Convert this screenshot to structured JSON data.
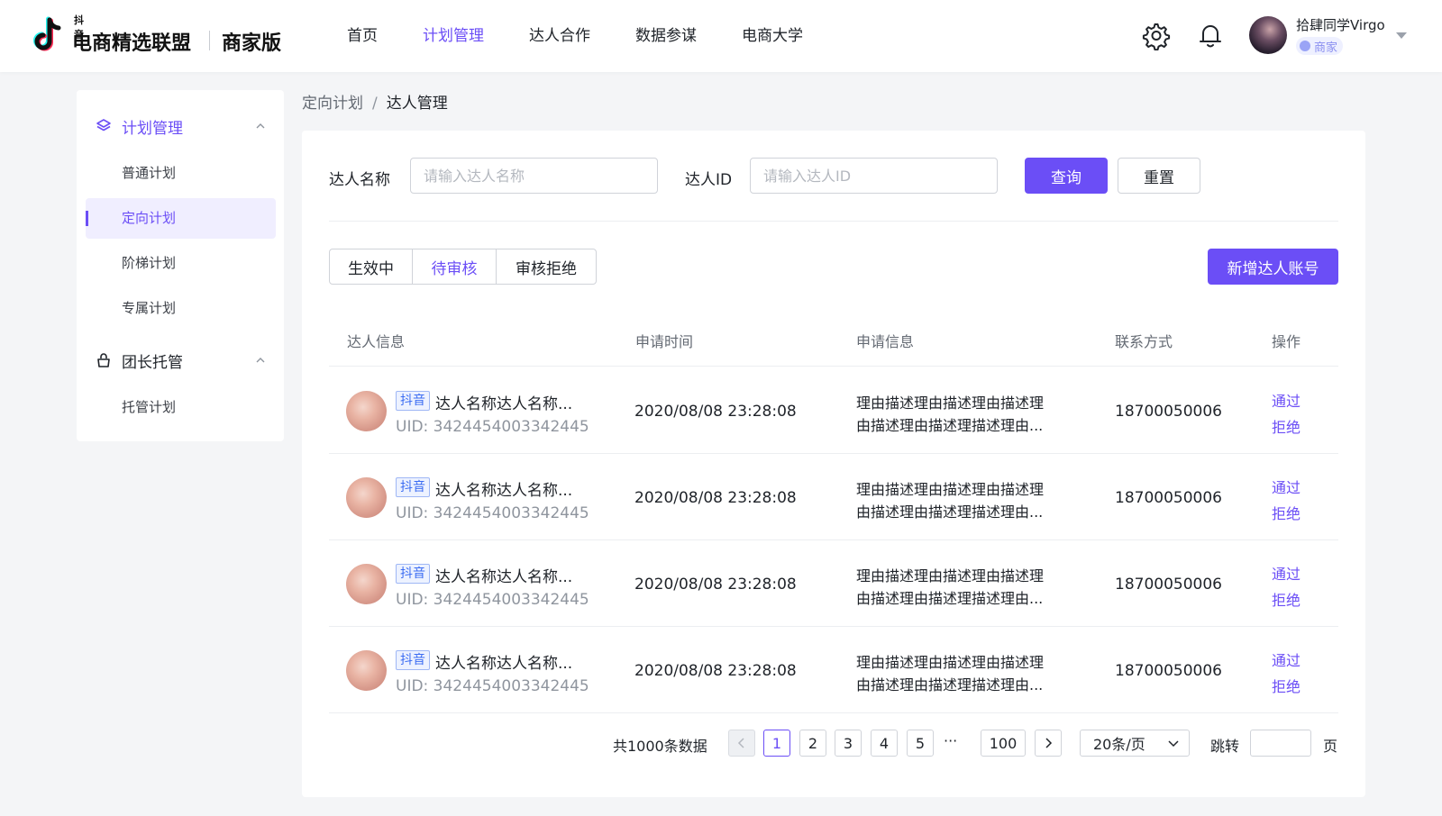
{
  "header": {
    "logo_small": "抖音",
    "logo_main": "电商精选联盟",
    "logo_edition": "商家版",
    "nav": [
      {
        "label": "首页",
        "active": false
      },
      {
        "label": "计划管理",
        "active": true
      },
      {
        "label": "达人合作",
        "active": false
      },
      {
        "label": "数据参谋",
        "active": false
      },
      {
        "label": "电商大学",
        "active": false
      }
    ],
    "icons": [
      "settings-icon",
      "bell-icon"
    ],
    "user": {
      "name": "拾肆同学Virgo",
      "role": "商家"
    }
  },
  "sidebar": {
    "groups": [
      {
        "label": "计划管理",
        "icon": "layers-icon",
        "expanded": true,
        "active": true,
        "items": [
          {
            "label": "普通计划",
            "active": false
          },
          {
            "label": "定向计划",
            "active": true
          },
          {
            "label": "阶梯计划",
            "active": false
          },
          {
            "label": "专属计划",
            "active": false
          }
        ]
      },
      {
        "label": "团长托管",
        "icon": "handbag-icon",
        "expanded": true,
        "active": false,
        "items": [
          {
            "label": "托管计划",
            "active": false
          }
        ]
      }
    ]
  },
  "breadcrumb": {
    "parent": "定向计划",
    "separator": "/",
    "current": "达人管理"
  },
  "filters": {
    "name_label": "达人名称",
    "name_placeholder": "请输入达人名称",
    "id_label": "达人ID",
    "id_placeholder": "请输入达人ID",
    "query_button": "查询",
    "reset_button": "重置"
  },
  "tabs": [
    {
      "label": "生效中",
      "active": false
    },
    {
      "label": "待审核",
      "active": true
    },
    {
      "label": "审核拒绝",
      "active": false
    }
  ],
  "add_button": "新增达人账号",
  "table": {
    "columns": [
      "达人信息",
      "申请时间",
      "申请信息",
      "联系方式",
      "操作"
    ],
    "rows": [
      {
        "platform": "抖音",
        "name": "达人名称达人名称...",
        "uid": "UID: 3424454003342445",
        "time": "2020/08/08  23:28:08",
        "info_line1": "理由描述理由描述理由描述理",
        "info_line2": "由描述理由描述理描述理由...",
        "phone": "18700050006",
        "approve": "通过",
        "reject": "拒绝"
      },
      {
        "platform": "抖音",
        "name": "达人名称达人名称...",
        "uid": "UID: 3424454003342445",
        "time": "2020/08/08  23:28:08",
        "info_line1": "理由描述理由描述理由描述理",
        "info_line2": "由描述理由描述理描述理由...",
        "phone": "18700050006",
        "approve": "通过",
        "reject": "拒绝"
      },
      {
        "platform": "抖音",
        "name": "达人名称达人名称...",
        "uid": "UID: 3424454003342445",
        "time": "2020/08/08  23:28:08",
        "info_line1": "理由描述理由描述理由描述理",
        "info_line2": "由描述理由描述理描述理由...",
        "phone": "18700050006",
        "approve": "通过",
        "reject": "拒绝"
      },
      {
        "platform": "抖音",
        "name": "达人名称达人名称...",
        "uid": "UID: 3424454003342445",
        "time": "2020/08/08  23:28:08",
        "info_line1": "理由描述理由描述理由描述理",
        "info_line2": "由描述理由描述理描述理由...",
        "phone": "18700050006",
        "approve": "通过",
        "reject": "拒绝"
      }
    ]
  },
  "pagination": {
    "total": "共1000条数据",
    "pages": [
      "1",
      "2",
      "3",
      "4",
      "5"
    ],
    "current_page": "1",
    "ellipsis": "···",
    "last_page": "100",
    "page_size": "20条/页",
    "jump_label": "跳转",
    "jump_suffix": "页"
  },
  "colors": {
    "accent": "#6b4ef6",
    "tag_blue": "#3b6cf2",
    "muted": "#8f959e"
  }
}
